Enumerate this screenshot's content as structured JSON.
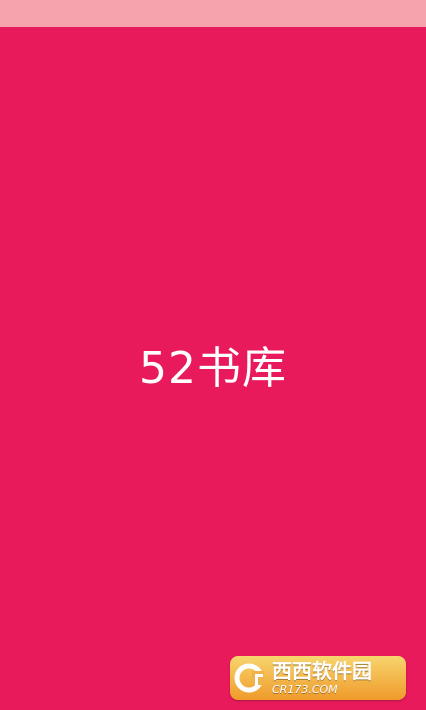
{
  "splash": {
    "title": "52书库",
    "background_color": "#e91a5c",
    "status_bar_color": "#f7a3ad"
  },
  "watermark": {
    "logo_text": "西西软件园",
    "domain": "CR173.COM",
    "icon": "cr-logo-icon"
  }
}
